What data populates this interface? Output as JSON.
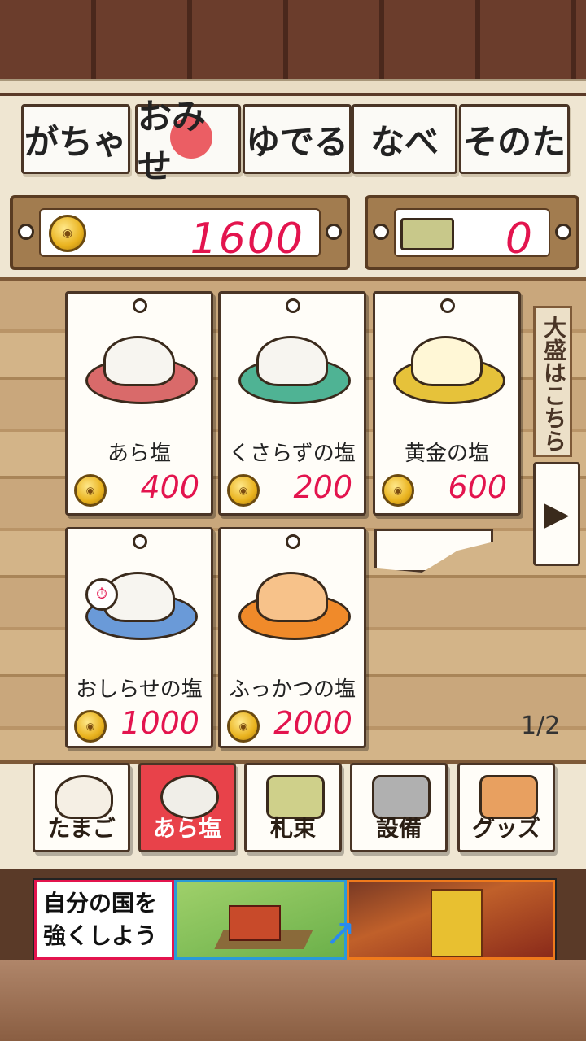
{
  "tabs": [
    {
      "label": "がちゃ"
    },
    {
      "label": "おみせ",
      "active": true
    },
    {
      "label": "ゆでる"
    },
    {
      "label": "なべ"
    },
    {
      "label": "そのた"
    }
  ],
  "currency": {
    "coins": "1600",
    "money": "0"
  },
  "items": [
    {
      "name": "あら塩",
      "price": "400",
      "plate_color": "#d96a6a"
    },
    {
      "name": "くさらずの塩",
      "price": "200",
      "plate_color": "#4fb394"
    },
    {
      "name": "黄金の塩",
      "price": "600",
      "plate_color": "#e6c23a"
    },
    {
      "name": "おしらせの塩",
      "price": "1000",
      "plate_color": "#6a9ad8"
    },
    {
      "name": "ふっかつの塩",
      "price": "2000",
      "plate_color": "#f08a2a"
    }
  ],
  "side_label": "大盛はこちら",
  "page_indicator": "1/2",
  "bottom": [
    {
      "label": "たまご",
      "active": false
    },
    {
      "label": "あら塩",
      "active": true
    },
    {
      "label": "札束",
      "active": false
    },
    {
      "label": "設備",
      "active": false
    },
    {
      "label": "グッズ",
      "active": false
    }
  ],
  "ad": {
    "text_line1": "自分の国を",
    "text_line2": "強くしよう"
  }
}
